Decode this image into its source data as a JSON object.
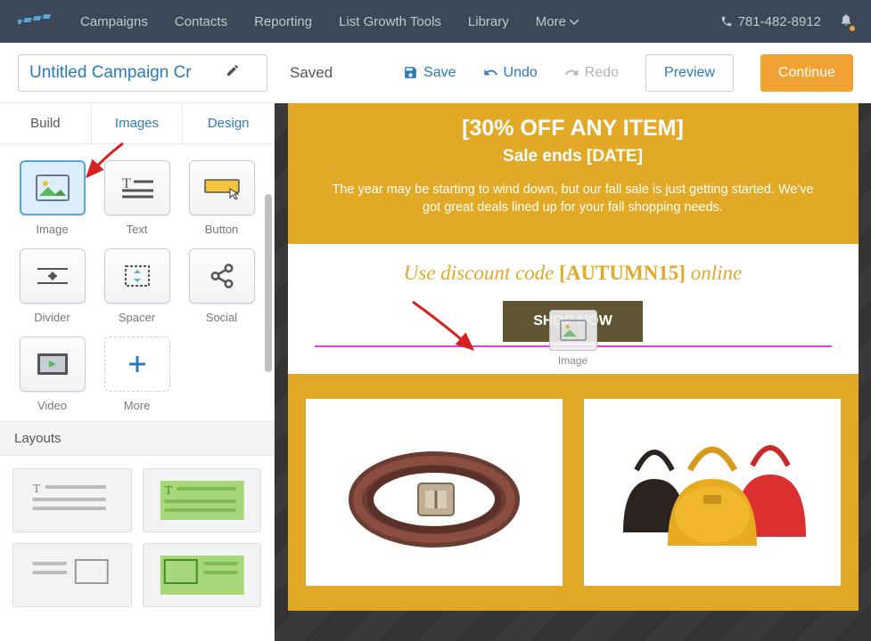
{
  "nav": {
    "items": [
      "Campaigns",
      "Contacts",
      "Reporting",
      "List Growth Tools",
      "Library",
      "More"
    ],
    "phone": "781-482-8912"
  },
  "toolbar": {
    "title": "Untitled Campaign Cr",
    "status": "Saved",
    "save": "Save",
    "undo": "Undo",
    "redo": "Redo",
    "preview": "Preview",
    "continue": "Continue"
  },
  "tabs": [
    "Build",
    "Images",
    "Design"
  ],
  "blocks": [
    {
      "label": "Image",
      "icon": "image"
    },
    {
      "label": "Text",
      "icon": "text"
    },
    {
      "label": "Button",
      "icon": "button"
    },
    {
      "label": "Divider",
      "icon": "divider"
    },
    {
      "label": "Spacer",
      "icon": "spacer"
    },
    {
      "label": "Social",
      "icon": "social"
    },
    {
      "label": "Video",
      "icon": "video"
    },
    {
      "label": "More",
      "icon": "more"
    }
  ],
  "layouts_header": "Layouts",
  "email": {
    "hero_title": "[30% OFF ANY ITEM]",
    "hero_subtitle": "Sale ends [DATE]",
    "hero_body": "The year may be starting to wind down, but our fall sale is just getting started. We've got great deals lined up for your fall shopping needs.",
    "promo_prefix": "Use discount code ",
    "promo_code": "[AUTUMN15]",
    "promo_suffix": " online",
    "shop_button": "SHOP NOW",
    "drop_label": "Image"
  },
  "colors": {
    "brand_gold": "#e1a925",
    "nav_bg": "#3c4858",
    "link_blue": "#2b7bb9",
    "cta_orange": "#f0a232",
    "drop_line": "#e83ae8"
  }
}
